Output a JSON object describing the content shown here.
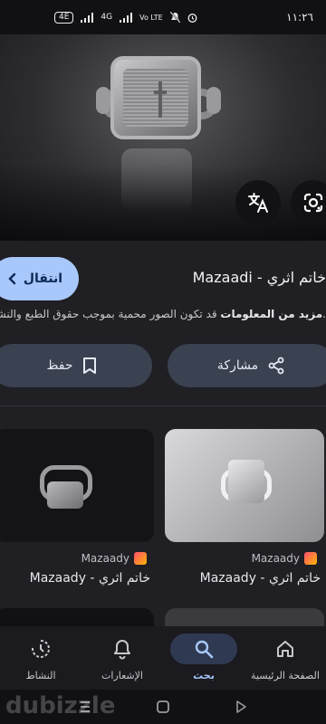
{
  "status_bar": {
    "network_badge": "4E",
    "network_type": "4G",
    "volte": "Vo LTE",
    "time": "١١:٢٦"
  },
  "hero": {
    "translate_icon": "translate-icon",
    "lens_icon": "google-lens-icon"
  },
  "panel": {
    "visit_label": "انتقال",
    "title": "Mazaadi - خاتم اثري",
    "copyright_prefix": "قد تكون الصور محمية بموجب حقوق الطبع والنشر.",
    "copyright_link": "مزيد من المعلومات",
    "share_label": "مشاركة",
    "save_label": "حفظ"
  },
  "results": [
    {
      "source": "Mazaady",
      "title": "Mazaady - خاتم اثري"
    },
    {
      "source": "Mazaady",
      "title": "Mazaady - خاتم اثري"
    }
  ],
  "bottom_nav": [
    {
      "label": "الصفحة الرئيسية",
      "icon": "home-icon"
    },
    {
      "label": "بحث",
      "icon": "search-icon",
      "active": true
    },
    {
      "label": "الإشعارات",
      "icon": "bell-icon"
    },
    {
      "label": "النشاط",
      "icon": "history-icon"
    }
  ],
  "watermark": "dubizzle",
  "colors": {
    "accent": "#a8c7fa",
    "background": "#1f1f24",
    "button": "#3a4150"
  }
}
